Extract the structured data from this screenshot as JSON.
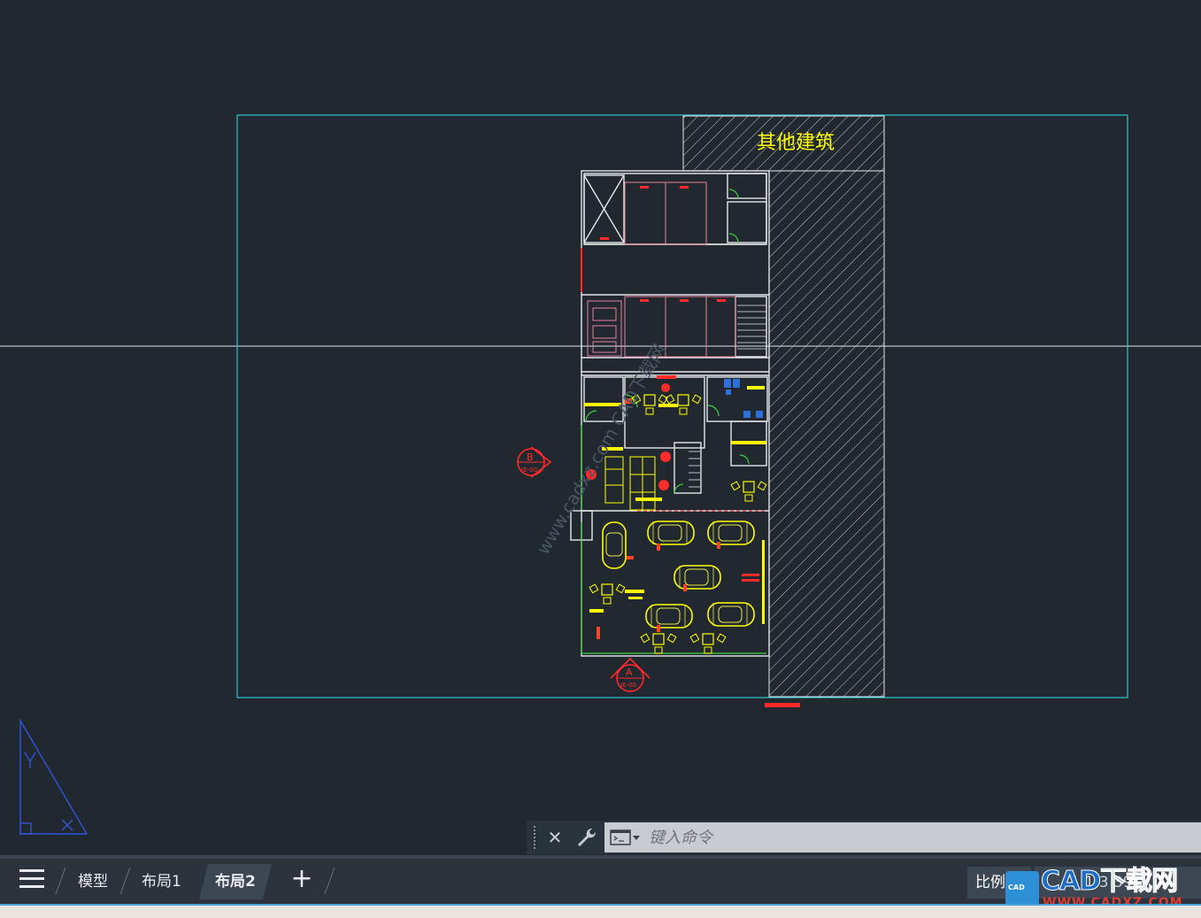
{
  "drawing": {
    "building_label": "其他建筑",
    "watermark_diag": "www.cadxz.com  CAD下载网",
    "markers": [
      {
        "letter": "B",
        "sheet": "IE-00"
      },
      {
        "letter": "A",
        "sheet": "IE-00"
      }
    ]
  },
  "command_line": {
    "close_icon": "close-icon",
    "settings_icon": "wrench-icon",
    "prompt_icon": "command-prompt-icon",
    "placeholder": "键入命令"
  },
  "tabs": {
    "menu_icon": "hamburger-icon",
    "items": [
      {
        "label": "模型",
        "active": false
      },
      {
        "label": "布局1",
        "active": false
      },
      {
        "label": "布局2",
        "active": true
      }
    ],
    "add_icon": "plus-icon"
  },
  "status": {
    "scale_label": "比例",
    "scale_value": "1:1 3 39"
  },
  "watermark": {
    "logo_text": "CAD",
    "title": "CAD下载网",
    "url": "WWW.CADXZ.COM"
  },
  "colors": {
    "background": "#212830",
    "viewport_border": "#2fc4c9",
    "walls": "#ffffff",
    "cars": "#ffff00",
    "markers": "#ff2a2a",
    "tab_active": "#3d4653"
  }
}
